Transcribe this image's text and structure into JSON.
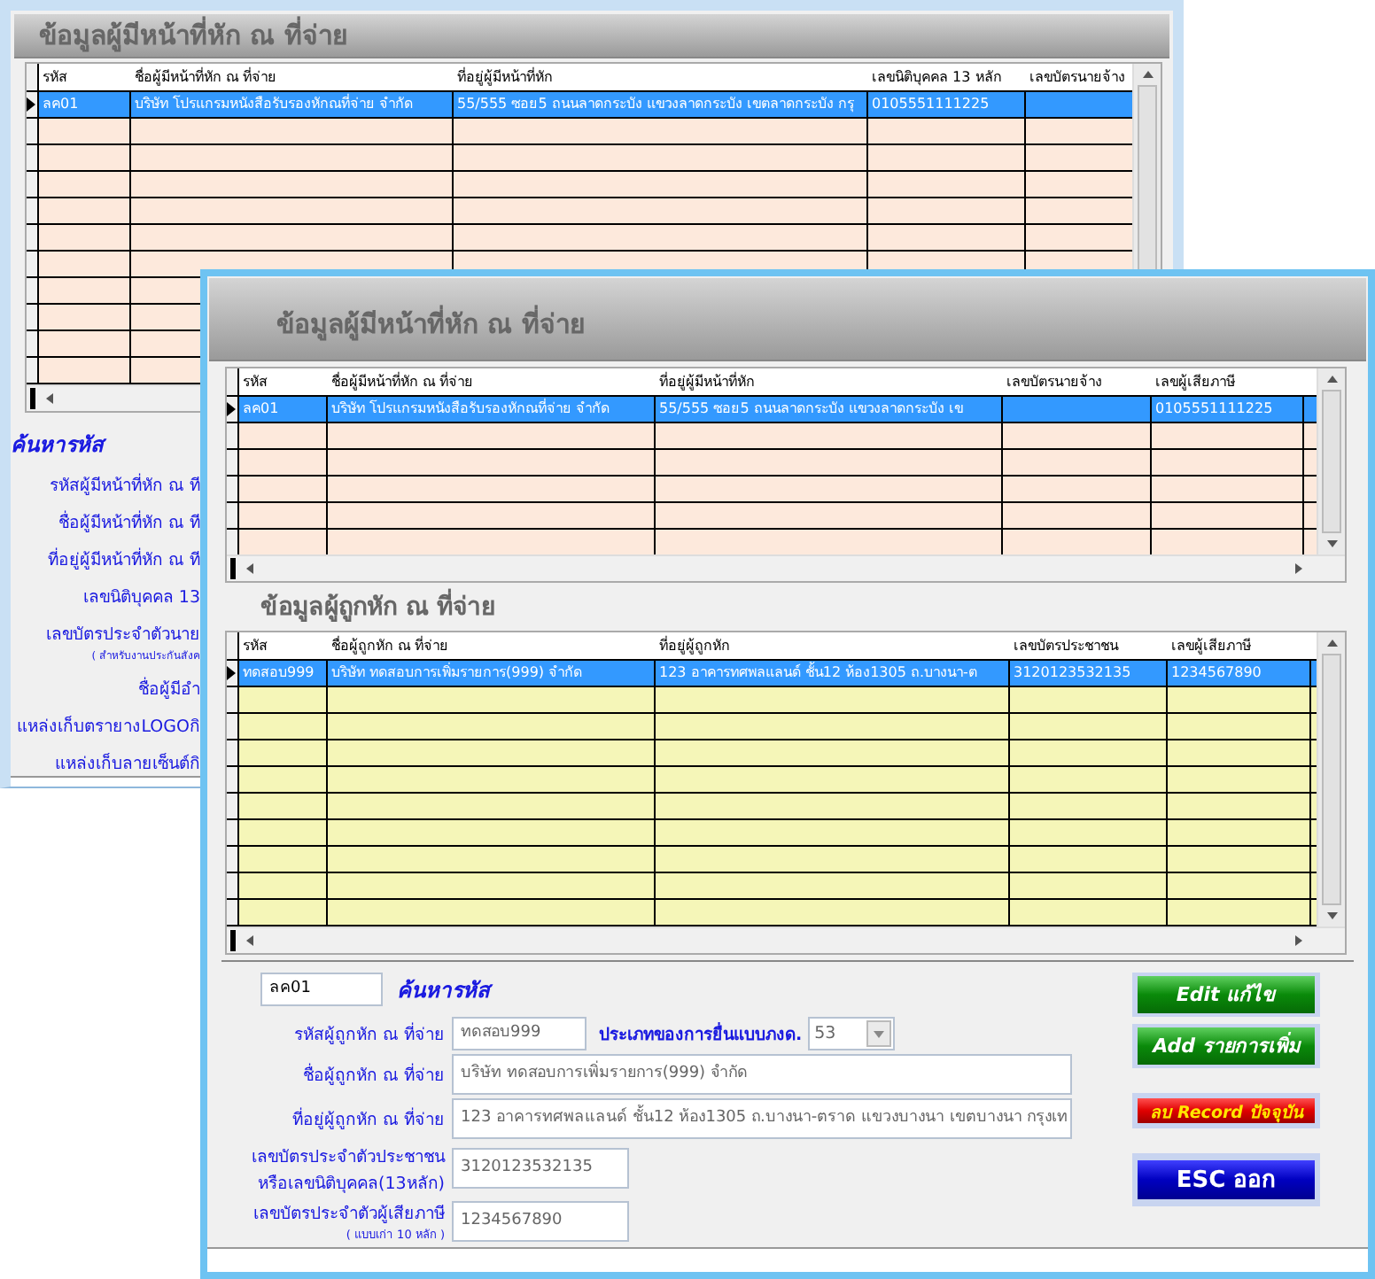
{
  "back_window": {
    "title": "ข้อมูลผู้มีหน้าที่หัก ณ ที่จ่าย",
    "grid": {
      "columns": [
        "รหัส",
        "ชื่อผู้มีหน้าที่หัก ณ ที่จ่าย",
        "ที่อยู่ผู้มีหน้าที่หัก",
        "เลขนิติบุคคล 13 หลัก",
        "เลขบัตรนายจ้าง"
      ],
      "rows": [
        {
          "selected": true,
          "cells": [
            "ลค01",
            "บริษัท โปรแกรมหนังสือรับรองหักณที่จ่าย จำกัด",
            "55/555 ซอย5 ถนนลาดกระบัง แขวงลาดกระบัง เขตลาดกระบัง กรุ",
            "0105551111225",
            ""
          ]
        }
      ]
    },
    "search_label": "ค้นหารหัส",
    "labels": [
      {
        "text": "รหัสผู้มีหน้าที่หัก ณ ที"
      },
      {
        "text": "ชื่อผู้มีหน้าที่หัก ณ ที"
      },
      {
        "text": "ที่อยู่ผู้มีหน้าที่หัก ณ ที"
      },
      {
        "text": "เลขนิติบุคคล 13"
      },
      {
        "text": "เลขบัตรประจำตัวนาย",
        "note": "( สำหรับงานประกันสังค"
      },
      {
        "text": "ชื่อผู้มีอำ"
      },
      {
        "text": "แหล่งเก็บตรายางLOGOกิ"
      },
      {
        "text": "แหล่งเก็บลายเซ็นต์กิ"
      }
    ]
  },
  "front_window": {
    "title": "ข้อมูลผู้มีหน้าที่หัก ณ ที่จ่าย",
    "payer_grid": {
      "columns": [
        "รหัส",
        "ชื่อผู้มีหน้าที่หัก ณ ที่จ่าย",
        "ที่อยู่ผู้มีหน้าที่หัก",
        "เลขบัตรนายจ้าง",
        "เลขผู้เสียภาษี"
      ],
      "rows": [
        {
          "selected": true,
          "cells": [
            "ลค01",
            "บริษัท โปรแกรมหนังสือรับรองหักณที่จ่าย จำกัด",
            "55/555 ซอย5 ถนนลาดกระบัง แขวงลาดกระบัง เข",
            "",
            "0105551111225"
          ]
        }
      ]
    },
    "payee_title": "ข้อมูลผู้ถูกหัก ณ ที่จ่าย",
    "payee_grid": {
      "columns": [
        "รหัส",
        "ชื่อผู้ถูกหัก ณ ที่จ่าย",
        "ที่อยู่ผู้ถูกหัก",
        "เลขบัตรประชาชน",
        "เลขผู้เสียภาษี"
      ],
      "rows": [
        {
          "selected": true,
          "cells": [
            "ทดสอบ999",
            "บริษัท ทดสอบการเพิ่มรายการ(999) จำกัด",
            "123 อาคารทศพลแลนด์ ชั้น12 ห้อง1305 ถ.บางนา-ต",
            "3120123532135",
            "1234567890"
          ]
        }
      ]
    },
    "search": {
      "value": "ลค01",
      "label": "ค้นหารหัส"
    },
    "fields": [
      {
        "label": "รหัสผู้ถูกหัก ณ ที่จ่าย",
        "value": "ทดสอบ999",
        "kind": "short",
        "filing_type": {
          "label": "ประเภทของการยื่นแบบภงด.",
          "value": "53"
        }
      },
      {
        "label": "ชื่อผู้ถูกหัก ณ ที่จ่าย",
        "value": "บริษัท ทดสอบการเพิ่มรายการ(999) จำกัด",
        "kind": "long"
      },
      {
        "label": "ที่อยู่ผู้ถูกหัก ณ ที่จ่าย",
        "value": "123 อาคารทศพลแลนด์ ชั้น12 ห้อง1305 ถ.บางนา-ตราด แขวงบางนา เขตบางนา กรุงเท",
        "kind": "long"
      },
      {
        "label": "เลขบัตรประจำตัวประชาชน",
        "label_line_2": "หรือเลขนิติบุคคล(13หลัก)",
        "value": "3120123532135",
        "kind": "medium"
      },
      {
        "label": "เลขบัตรประจำตัวผู้เสียภาษี",
        "note": "( แบบเก่า 10 หลัก )",
        "value": "1234567890",
        "kind": "medium"
      }
    ],
    "buttons": [
      {
        "label": "Edit แก้ไข",
        "kind": "green"
      },
      {
        "label": "Add รายการเพิ่ม",
        "kind": "green"
      },
      {
        "label": "ลบ Record ปัจจุบัน",
        "kind": "red"
      },
      {
        "label": "ESC  ออก",
        "kind": "blue"
      }
    ]
  }
}
